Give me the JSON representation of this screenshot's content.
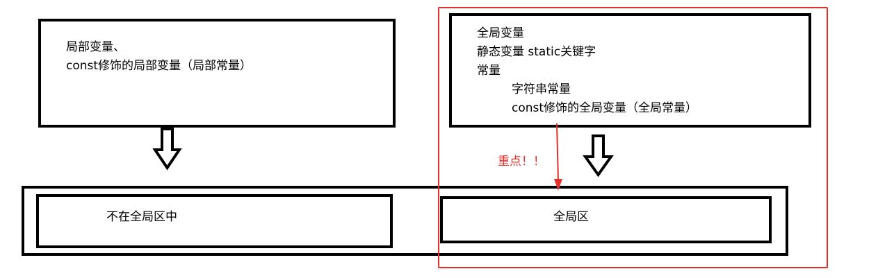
{
  "left_box": {
    "lines": [
      "局部变量、",
      "const修饰的局部变量（局部常量）"
    ]
  },
  "right_box": {
    "lines": [
      "全局变量",
      "静态变量  static关键字",
      "常量",
      "字符串常量",
      "const修饰的全局变量（全局常量）"
    ]
  },
  "bottom": {
    "left_label": "不在全局区中",
    "right_label": "全局区"
  },
  "annotation": {
    "text": "重点！！",
    "color": "#e3302a"
  },
  "colors": {
    "stroke": "#000000",
    "highlight": "#e3302a"
  }
}
